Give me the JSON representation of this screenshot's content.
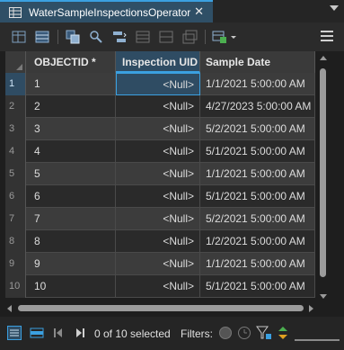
{
  "tab": {
    "title": "WaterSampleInspectionsOperator",
    "close_glyph": "✕"
  },
  "toolbar": {
    "icons": [
      "field-view-icon",
      "calculate-icon",
      "select-by-attributes-icon",
      "zoom-to-selection-icon",
      "switch-selection-icon",
      "clear-selection-icon",
      "delete-selection-icon",
      "copy-selection-icon",
      "highlight-icon",
      "add-field-menu-icon"
    ]
  },
  "table": {
    "columns": [
      "OBJECTID *",
      "Inspection UID",
      "Sample Date"
    ],
    "rows": [
      {
        "n": "1",
        "oid": "1",
        "uid": "<Null>",
        "date": "1/1/2021 5:00:00 AM"
      },
      {
        "n": "2",
        "oid": "2",
        "uid": "<Null>",
        "date": "4/27/2023 5:00:00 AM"
      },
      {
        "n": "3",
        "oid": "3",
        "uid": "<Null>",
        "date": "5/2/2021 5:00:00 AM"
      },
      {
        "n": "4",
        "oid": "4",
        "uid": "<Null>",
        "date": "5/1/2021 5:00:00 AM"
      },
      {
        "n": "5",
        "oid": "5",
        "uid": "<Null>",
        "date": "1/1/2021 5:00:00 AM"
      },
      {
        "n": "6",
        "oid": "6",
        "uid": "<Null>",
        "date": "5/1/2021 5:00:00 AM"
      },
      {
        "n": "7",
        "oid": "7",
        "uid": "<Null>",
        "date": "5/2/2021 5:00:00 AM"
      },
      {
        "n": "8",
        "oid": "8",
        "uid": "<Null>",
        "date": "1/2/2021 5:00:00 AM"
      },
      {
        "n": "9",
        "oid": "9",
        "uid": "<Null>",
        "date": "1/1/2021 5:00:00 AM"
      },
      {
        "n": "10",
        "oid": "10",
        "uid": "<Null>",
        "date": "5/1/2021 5:00:00 AM"
      }
    ]
  },
  "status": {
    "selected": "0 of 10 selected",
    "filters_label": "Filters:"
  },
  "colors": {
    "accent": "#3ba0e0",
    "selected_tab": "#2f4f66",
    "row_odd": "#3c3c3c",
    "row_even": "#2a2a2a"
  }
}
